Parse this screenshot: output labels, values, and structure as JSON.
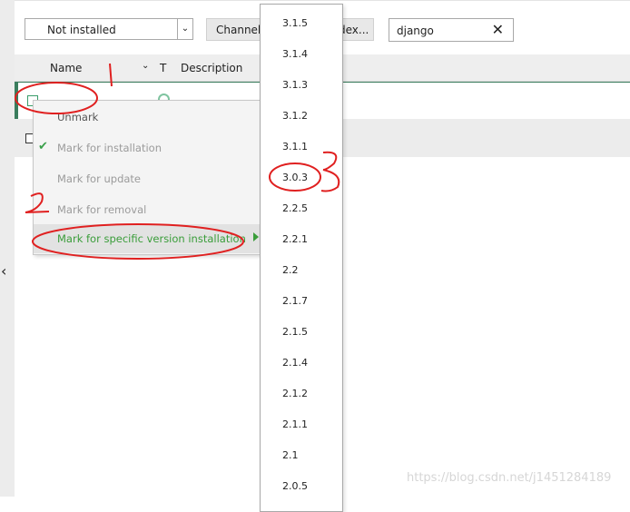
{
  "toolbar": {
    "environment_filter": "Not installed",
    "channels_label": "Channels",
    "index_label": "dex...",
    "search_value": "django",
    "clear_icon": "close-icon"
  },
  "table": {
    "header_name": "Name",
    "header_t": "T",
    "header_description": "Description"
  },
  "context_menu": {
    "items": [
      "Unmark",
      "Mark for installation",
      "Mark for update",
      "Mark for removal"
    ],
    "submenu_label": "Mark for specific version installation"
  },
  "versions": [
    "3.1.5",
    "3.1.4",
    "3.1.3",
    "3.1.2",
    "3.1.1",
    "3.0.3",
    "2.2.5",
    "2.2.1",
    "2.2",
    "2.1.7",
    "2.1.5",
    "2.1.4",
    "2.1.2",
    "2.1.1",
    "2.1",
    "2.0.5"
  ],
  "annotations": [
    "1",
    "2",
    "3"
  ],
  "watermark": "https://blog.csdn.net/j1451284189",
  "colors": {
    "accent_green": "#3a9d3a",
    "annotation_red": "#e02020"
  }
}
